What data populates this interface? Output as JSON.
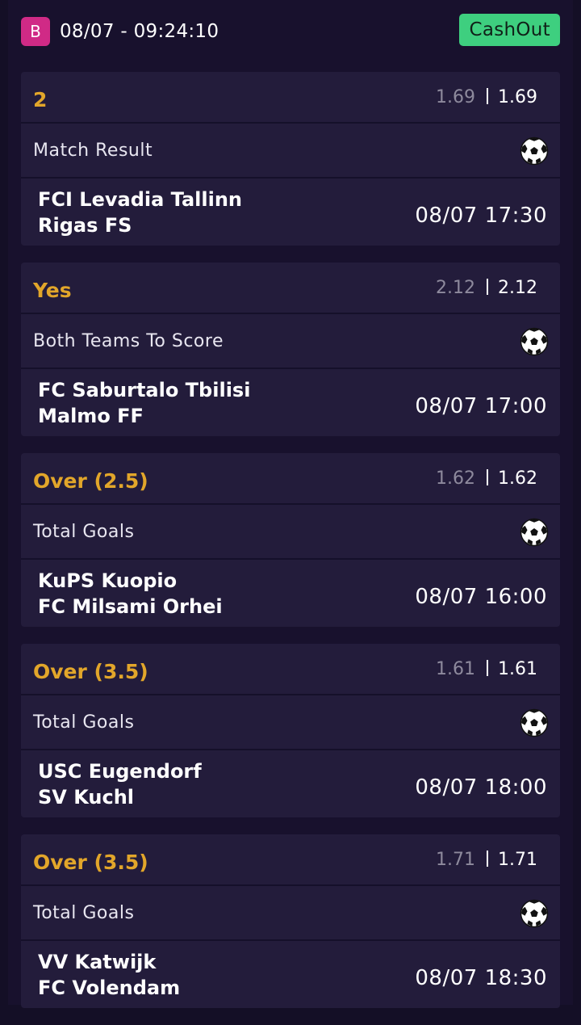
{
  "header": {
    "badge": "B",
    "datetime": "08/07 - 09:24:10",
    "cashout_label": "CashOut"
  },
  "colors": {
    "background": "#18112d",
    "card": "#231c3b",
    "selection_accent": "#e2a62a",
    "cashout_green": "#3ecf7f",
    "badge_pink": "#d02a86"
  },
  "selections": [
    {
      "pick": "2",
      "odds_original": "1.69",
      "odds_current": "1.69",
      "market": "Match Result",
      "sport_icon": "soccer-ball-icon",
      "home_team": "FCI Levadia Tallinn",
      "away_team": "Rigas FS",
      "kickoff": "08/07 17:30"
    },
    {
      "pick": "Yes",
      "odds_original": "2.12",
      "odds_current": "2.12",
      "market": "Both Teams To Score",
      "sport_icon": "soccer-ball-icon",
      "home_team": "FC Saburtalo Tbilisi",
      "away_team": "Malmo FF",
      "kickoff": "08/07 17:00"
    },
    {
      "pick": "Over (2.5)",
      "odds_original": "1.62",
      "odds_current": "1.62",
      "market": "Total Goals",
      "sport_icon": "soccer-ball-icon",
      "home_team": "KuPS Kuopio",
      "away_team": "FC Milsami Orhei",
      "kickoff": "08/07 16:00"
    },
    {
      "pick": "Over (3.5)",
      "odds_original": "1.61",
      "odds_current": "1.61",
      "market": "Total Goals",
      "sport_icon": "soccer-ball-icon",
      "home_team": "USC Eugendorf",
      "away_team": "SV Kuchl",
      "kickoff": "08/07 18:00"
    },
    {
      "pick": "Over (3.5)",
      "odds_original": "1.71",
      "odds_current": "1.71",
      "market": "Total Goals",
      "sport_icon": "soccer-ball-icon",
      "home_team": "VV Katwijk",
      "away_team": "FC Volendam",
      "kickoff": "08/07 18:30"
    }
  ]
}
